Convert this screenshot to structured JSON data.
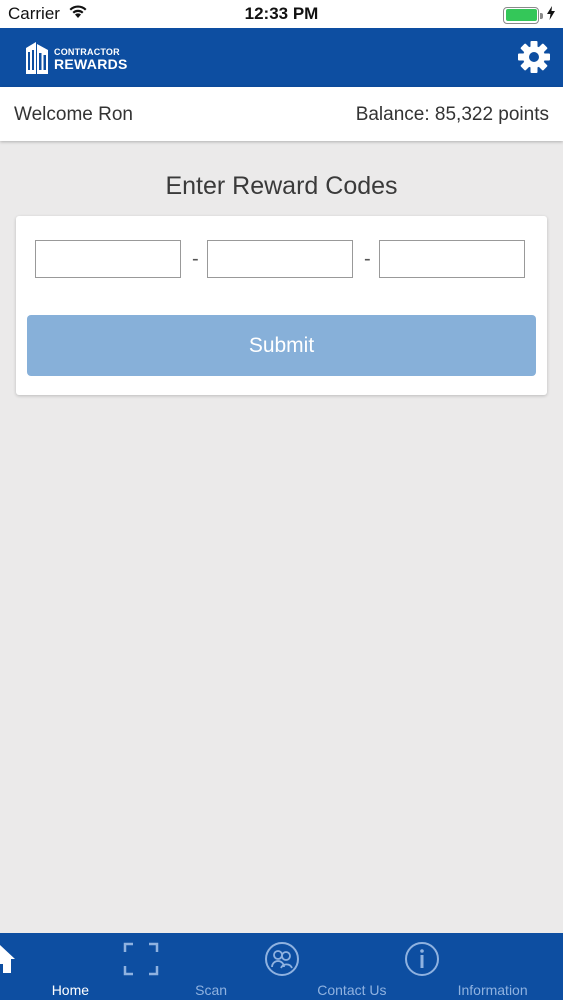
{
  "status_bar": {
    "carrier": "Carrier",
    "time": "12:33 PM",
    "battery_level": 1.0
  },
  "header": {
    "logo_top": "CONTRACTOR",
    "logo_bottom": "REWARDS",
    "settings_icon": "gear-icon"
  },
  "welcome": {
    "greeting": "Welcome Ron",
    "balance": "Balance: 85,322 points"
  },
  "main": {
    "title": "Enter Reward Codes",
    "code_fields": [
      {
        "value": "",
        "placeholder": ""
      },
      {
        "value": "",
        "placeholder": ""
      },
      {
        "value": "",
        "placeholder": ""
      }
    ],
    "separator": "-",
    "submit_label": "Submit"
  },
  "tabs": [
    {
      "label": "Home",
      "icon": "home-icon",
      "active": true
    },
    {
      "label": "Scan",
      "icon": "scan-icon",
      "active": false
    },
    {
      "label": "Contact Us",
      "icon": "contact-icon",
      "active": false
    },
    {
      "label": "Information",
      "icon": "info-icon",
      "active": false
    }
  ],
  "colors": {
    "brand_blue": "#0d4ea1",
    "submit_disabled": "#87b0d9",
    "background": "#ebeaea",
    "tab_inactive": "#8fb2e0",
    "battery_green": "#34c759"
  }
}
